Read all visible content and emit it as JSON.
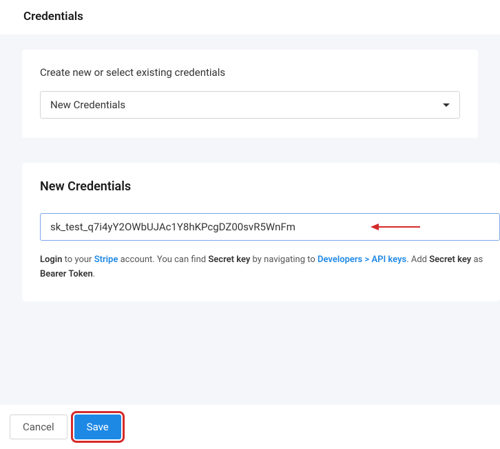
{
  "header": {
    "title": "Credentials"
  },
  "select_card": {
    "label": "Create new or select existing credentials",
    "selected": "New Credentials"
  },
  "new_cred": {
    "title": "New Credentials",
    "input_value": "sk_test_q7i4yY2OWbUJAc1Y8hKPcgDZ00svR5WnFm",
    "help": {
      "login_bold": "Login",
      "t1": " to your ",
      "stripe_link": "Stripe",
      "t2": " account. You can find ",
      "secret_key_bold": "Secret key",
      "t3": " by navigating to ",
      "dev_link": "Developers > API keys",
      "t4": ". Add ",
      "secret_key_bold2": "Secret key",
      "t5": " as ",
      "bearer_bold": "Bearer Token",
      "t6": "."
    }
  },
  "footer": {
    "cancel": "Cancel",
    "save": "Save"
  }
}
